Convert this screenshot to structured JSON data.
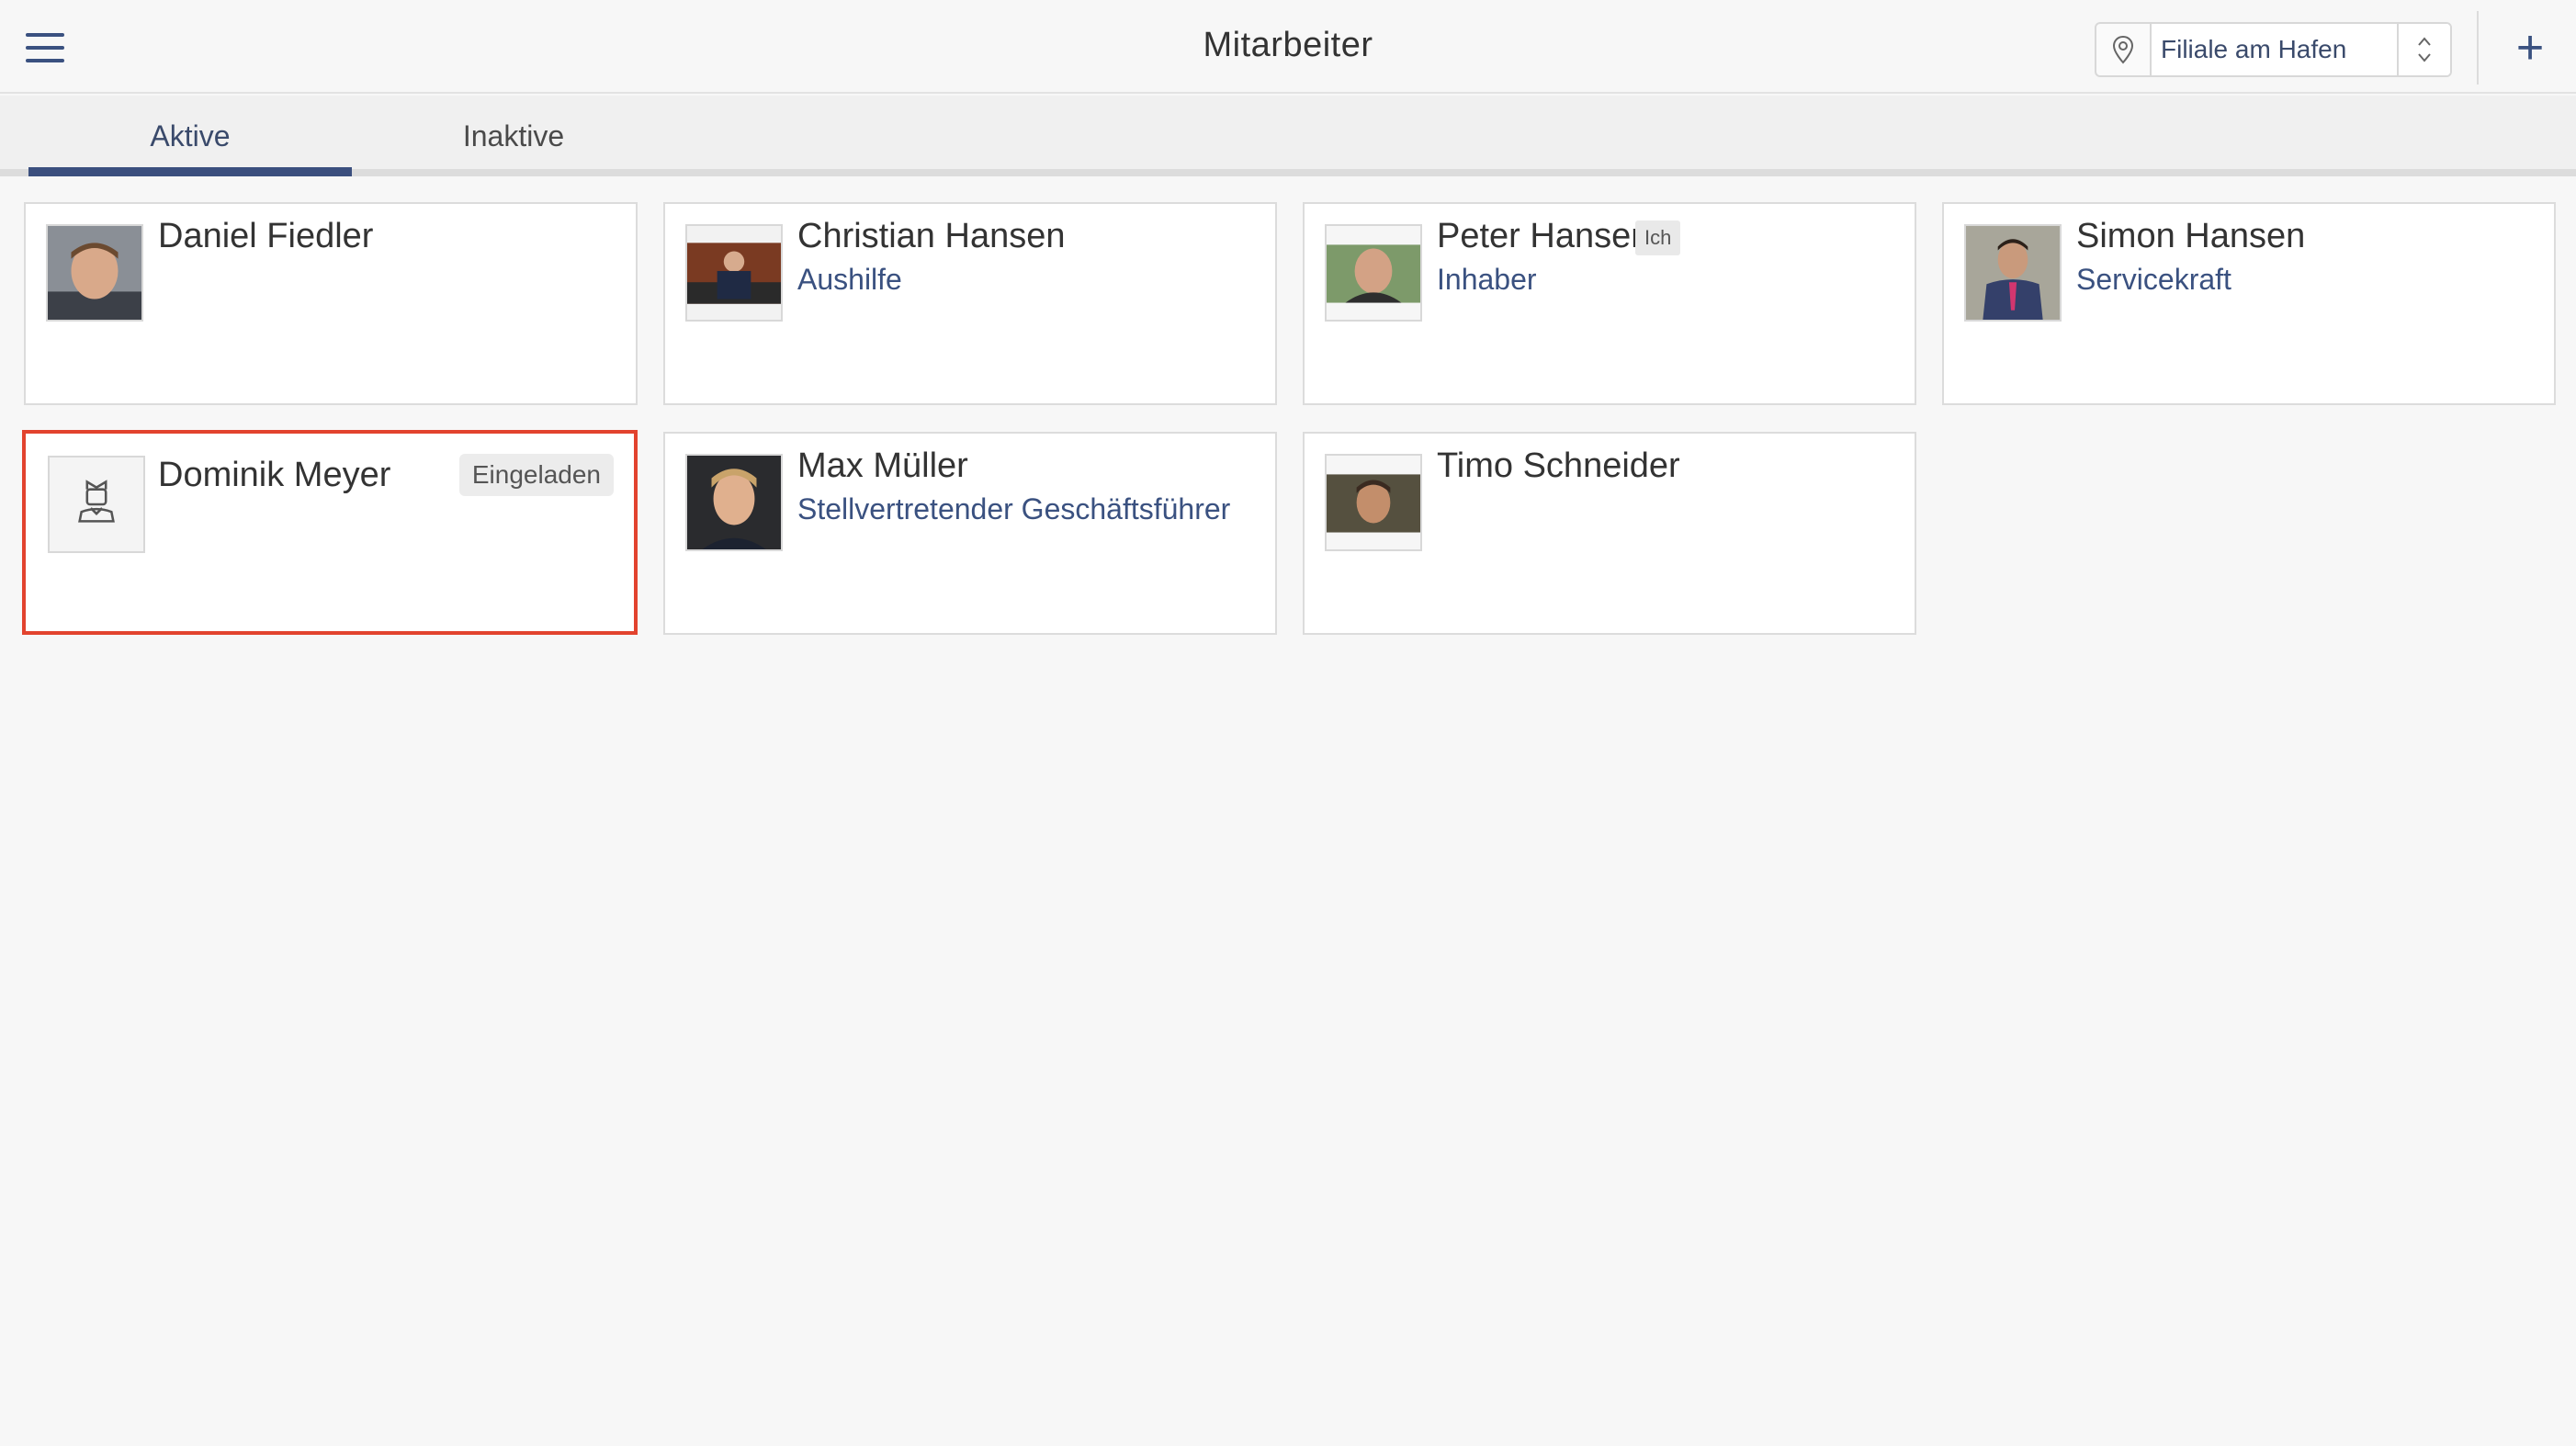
{
  "header": {
    "title": "Mitarbeiter",
    "location": "Filiale am Hafen",
    "add_label": "+"
  },
  "tabs": [
    {
      "label": "Aktive",
      "active": true
    },
    {
      "label": "Inaktive",
      "active": false
    }
  ],
  "employees": [
    {
      "name": "Daniel Fiedler",
      "role": "",
      "badge": ""
    },
    {
      "name": "Christian Hansen",
      "role": "Aushilfe",
      "badge": ""
    },
    {
      "name": "Peter Hansen",
      "role": "Inhaber",
      "badge": "Ich"
    },
    {
      "name": "Simon Hansen",
      "role": "Servicekraft",
      "badge": ""
    },
    {
      "name": "Dominik Meyer",
      "role": "",
      "badge": "Eingeladen",
      "selected": true
    },
    {
      "name": "Max Müller",
      "role": "Stellvertretender Geschäftsführer",
      "badge": ""
    },
    {
      "name": "Timo Schneider",
      "role": "",
      "badge": ""
    }
  ],
  "colors": {
    "accent": "#3b4f7e",
    "selection": "#e2432e",
    "role_text": "#3a5180"
  }
}
